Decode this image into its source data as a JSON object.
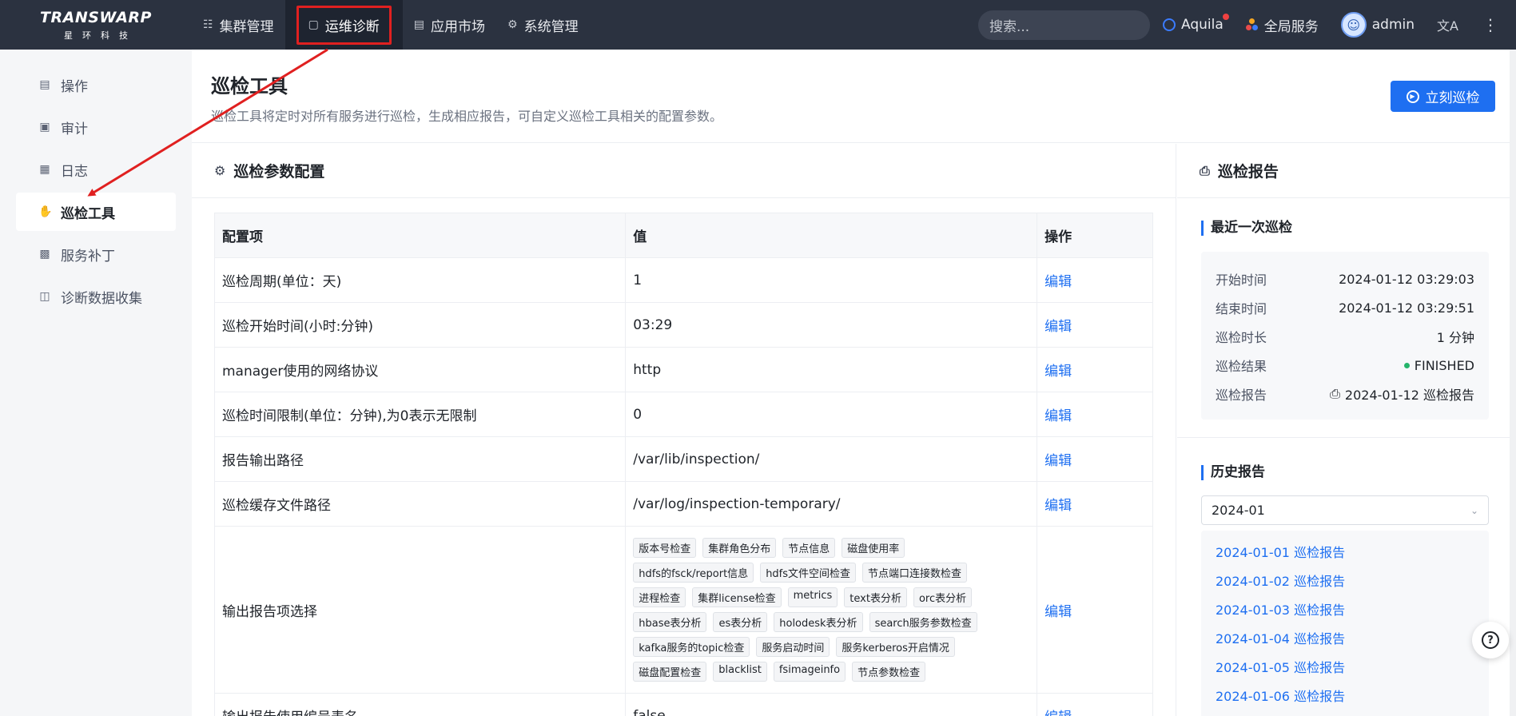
{
  "logo": {
    "brand": "TRANSWARP",
    "sub": "星环科技"
  },
  "nav": [
    {
      "label": "集群管理",
      "icon": "cluster-icon"
    },
    {
      "label": "运维诊断",
      "icon": "diagnose-icon",
      "active": true
    },
    {
      "label": "应用市场",
      "icon": "market-icon"
    },
    {
      "label": "系统管理",
      "icon": "gear-icon"
    }
  ],
  "topright": {
    "search_placeholder": "搜索...",
    "aquila": "Aquila",
    "global": "全局服务",
    "user": "admin"
  },
  "sidebar": [
    {
      "label": "操作"
    },
    {
      "label": "审计"
    },
    {
      "label": "日志"
    },
    {
      "label": "巡检工具",
      "active": true
    },
    {
      "label": "服务补丁"
    },
    {
      "label": "诊断数据收集"
    }
  ],
  "page": {
    "title": "巡检工具",
    "desc": "巡检工具将定时对所有服务进行巡检，生成相应报告，可自定义巡检工具相关的配置参数。",
    "run_button": "立刻巡检"
  },
  "config": {
    "title": "巡检参数配置",
    "headers": [
      "配置项",
      "值",
      "操作"
    ],
    "edit_label": "编辑",
    "rows": [
      {
        "key": "巡检周期(单位：天)",
        "value": "1"
      },
      {
        "key": "巡检开始时间(小时:分钟)",
        "value": "03:29"
      },
      {
        "key": "manager使用的网络协议",
        "value": "http"
      },
      {
        "key": "巡检时间限制(单位：分钟),为0表示无限制",
        "value": "0"
      },
      {
        "key": "报告输出路径",
        "value": "/var/lib/inspection/"
      },
      {
        "key": "巡检缓存文件路径",
        "value": "/var/log/inspection-temporary/"
      }
    ],
    "tags_row": {
      "key": "输出报告项选择",
      "tags": [
        "版本号检查",
        "集群角色分布",
        "节点信息",
        "磁盘使用率",
        "hdfs的fsck/report信息",
        "hdfs文件空间检查",
        "节点端口连接数检查",
        "进程检查",
        "集群license检查",
        "metrics",
        "text表分析",
        "orc表分析",
        "hbase表分析",
        "es表分析",
        "holodesk表分析",
        "search服务参数检查",
        "kafka服务的topic检查",
        "服务启动时间",
        "服务kerberos开启情况",
        "磁盘配置检查",
        "blacklist",
        "fsimageinfo",
        "节点参数检查"
      ]
    },
    "last_row": {
      "key": "输出报告使用编号表名",
      "value": "false"
    }
  },
  "report": {
    "title": "巡检报告",
    "latest_title": "最近一次巡检",
    "latest": [
      {
        "k": "开始时间",
        "v": "2024-01-12 03:29:03"
      },
      {
        "k": "结束时间",
        "v": "2024-01-12 03:29:51"
      },
      {
        "k": "巡检时长",
        "v": "1 分钟"
      },
      {
        "k": "巡检结果",
        "v": "FINISHED"
      },
      {
        "k": "巡检报告",
        "v": "2024-01-12 巡检报告"
      }
    ],
    "history_title": "历史报告",
    "month": "2024-01",
    "history": [
      "2024-01-01 巡检报告",
      "2024-01-02 巡检报告",
      "2024-01-03 巡检报告",
      "2024-01-04 巡检报告",
      "2024-01-05 巡检报告",
      "2024-01-06 巡检报告"
    ]
  },
  "colors": {
    "primary": "#1e6ff1",
    "topbar": "#2b3240",
    "highlight": "#e02020",
    "success": "#25b46b"
  }
}
